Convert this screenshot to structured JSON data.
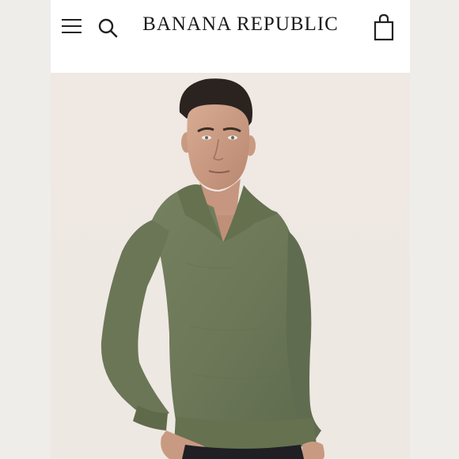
{
  "header": {
    "brand": "BANANA REPUBLIC",
    "icons": {
      "menu": "hamburger-menu-icon",
      "search": "search-icon",
      "bag": "shopping-bag-icon"
    }
  },
  "hero": {
    "image": "product-photo-man-in-olive-green-polo-sweater"
  },
  "colors": {
    "header_bg": "#ffffff",
    "photo_bg": "#efe9e4",
    "sweater": "#6f7c60"
  }
}
